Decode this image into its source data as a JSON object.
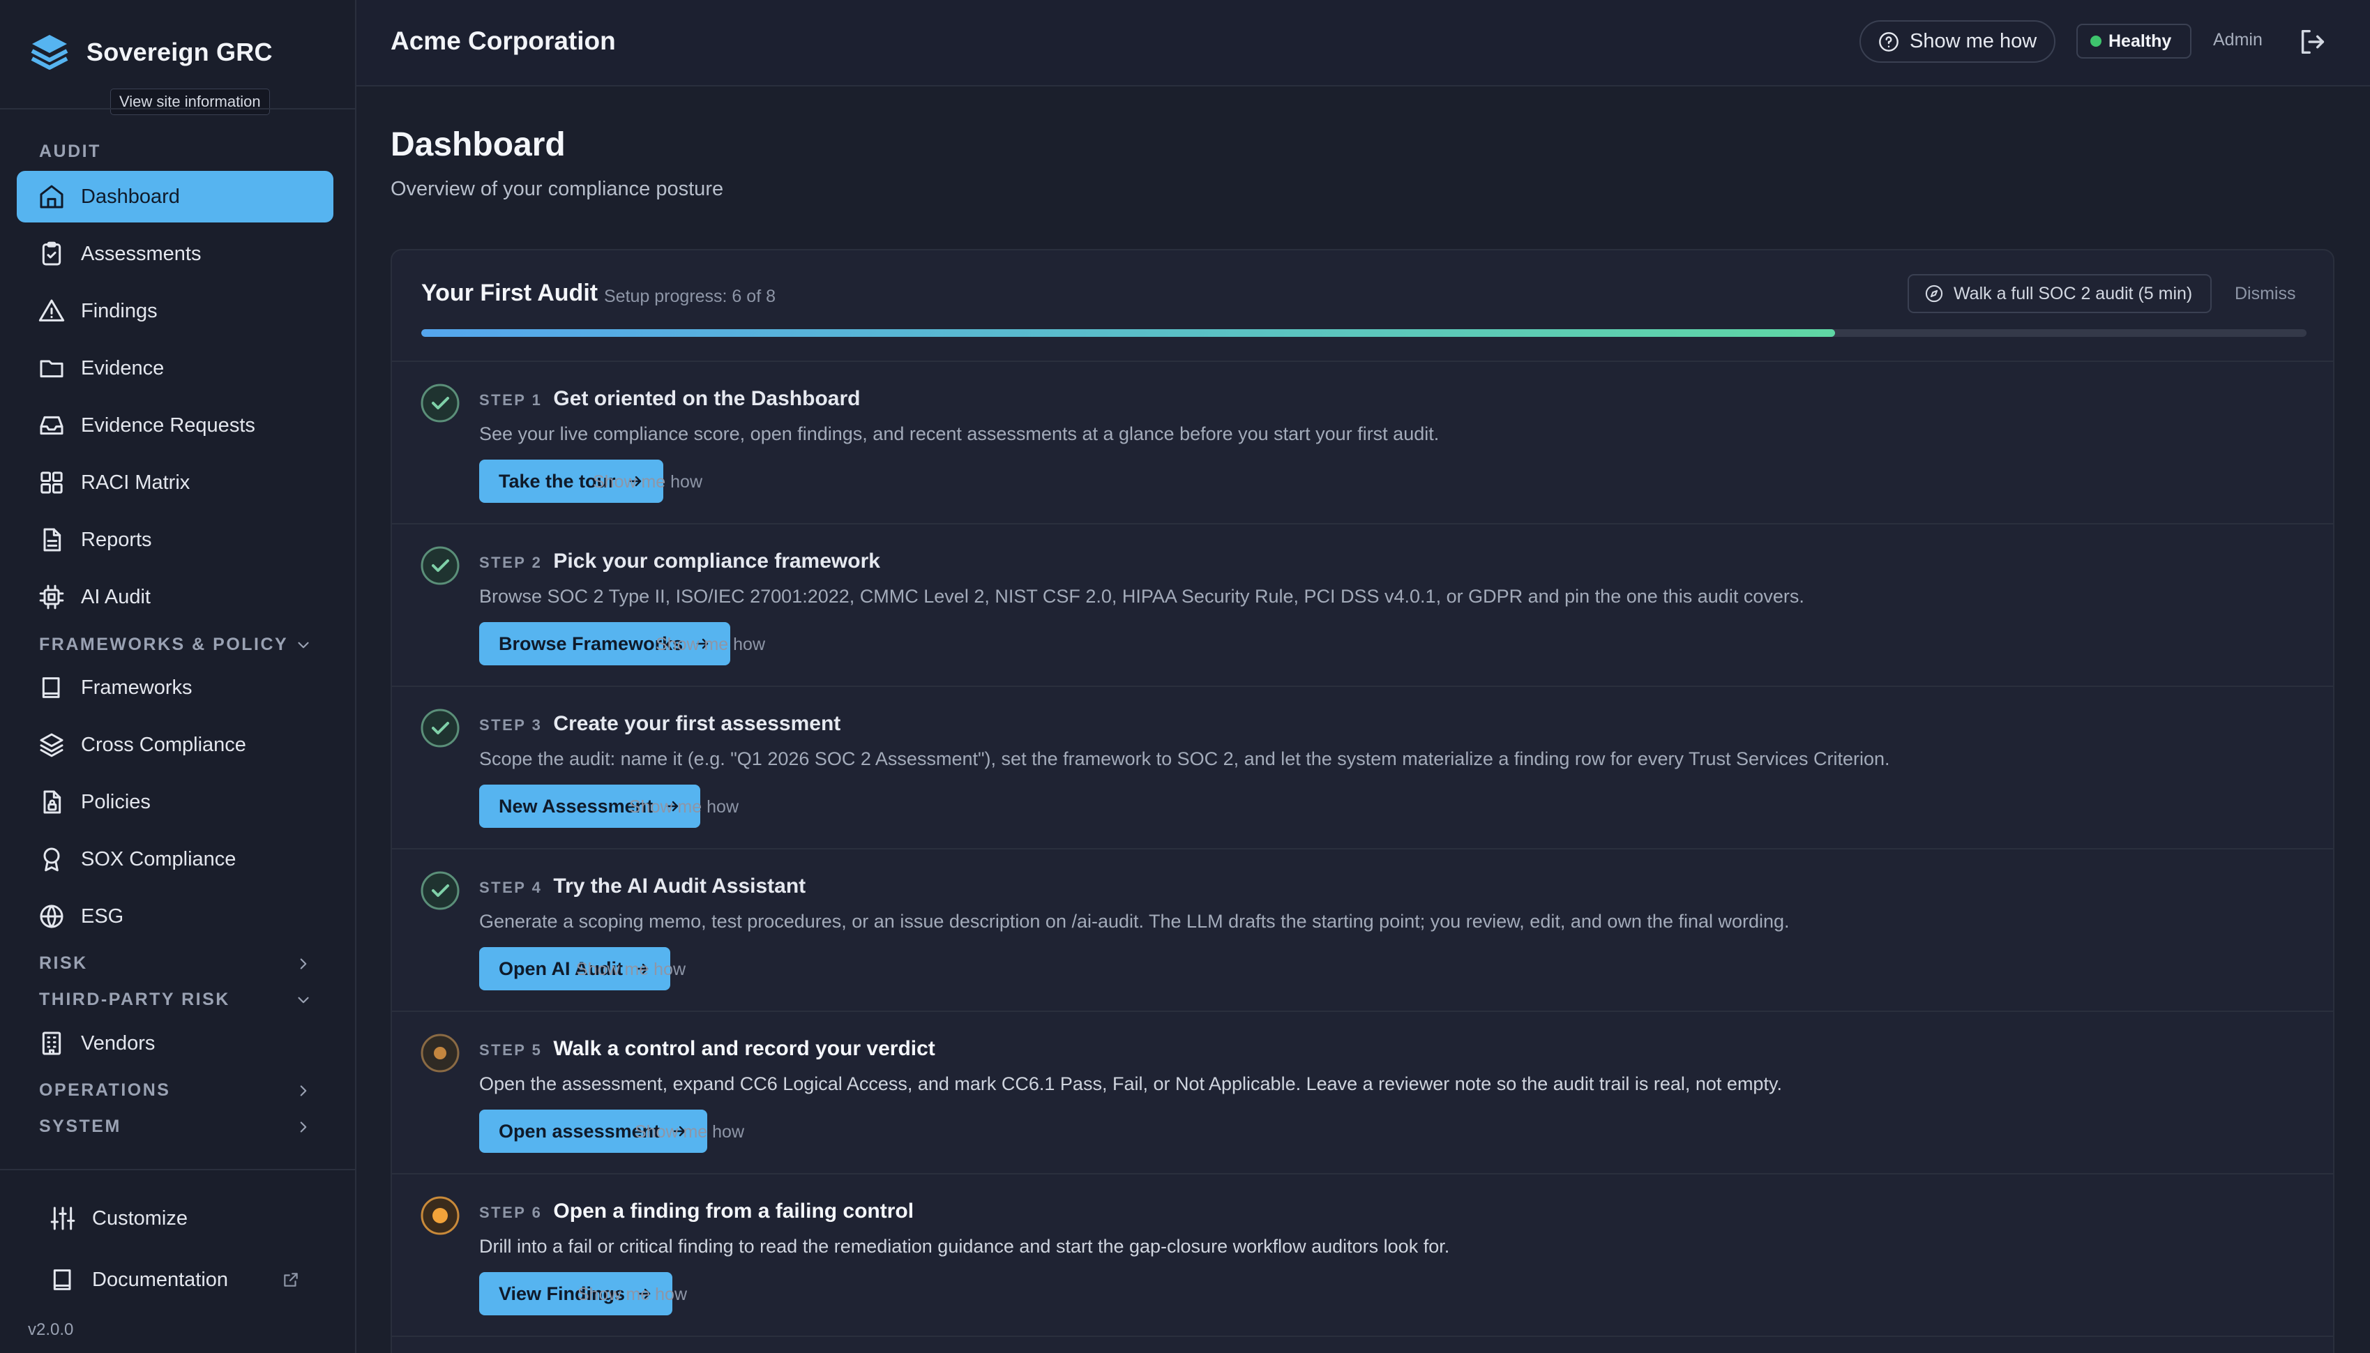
{
  "brand": {
    "name": "Sovereign GRC",
    "tooltip": "View site information"
  },
  "sidebar": {
    "sections": {
      "audit": "AUDIT",
      "frameworks": "FRAMEWORKS & POLICY",
      "risk": "RISK",
      "third_party": "THIRD-PARTY RISK",
      "operations": "OPERATIONS",
      "system": "SYSTEM"
    },
    "items": [
      {
        "label": "Dashboard",
        "icon": "home-icon",
        "active": true
      },
      {
        "label": "Assessments",
        "icon": "clipboard-check-icon"
      },
      {
        "label": "Findings",
        "icon": "warning-triangle-icon"
      },
      {
        "label": "Evidence",
        "icon": "folder-icon"
      },
      {
        "label": "Evidence Requests",
        "icon": "inbox-icon"
      },
      {
        "label": "RACI Matrix",
        "icon": "grid-icon"
      },
      {
        "label": "Reports",
        "icon": "document-icon"
      },
      {
        "label": "AI Audit",
        "icon": "cpu-icon"
      },
      {
        "label": "Frameworks",
        "icon": "book-icon"
      },
      {
        "label": "Cross Compliance",
        "icon": "layers-icon"
      },
      {
        "label": "Policies",
        "icon": "file-lock-icon"
      },
      {
        "label": "SOX Compliance",
        "icon": "award-icon"
      },
      {
        "label": "ESG",
        "icon": "globe-icon"
      },
      {
        "label": "Vendors",
        "icon": "building-icon"
      }
    ],
    "bottom": {
      "customize": "Customize",
      "documentation": "Documentation",
      "version": "v2.0.0"
    }
  },
  "header": {
    "org": "Acme Corporation",
    "show_me_how": "Show me how",
    "health": "Healthy",
    "health_color": "#3ec46d",
    "user": "Admin"
  },
  "page": {
    "title": "Dashboard",
    "subtitle": "Overview of your compliance posture"
  },
  "onboarding": {
    "title": "Your First Audit",
    "progress_text": "Setup progress: 6 of 8",
    "progress_fraction": 0.75,
    "walk_button": "Walk a full SOC 2 audit (5 min)",
    "dismiss": "Dismiss",
    "steps": [
      {
        "num": "STEP 1",
        "title": "Get oriented on the Dashboard",
        "desc": "See your live compliance score, open findings, and recent assessments at a glance before you start your first audit.",
        "button": "Take the tour",
        "how": "Show me how",
        "status": "done"
      },
      {
        "num": "STEP 2",
        "title": "Pick your compliance framework",
        "desc": "Browse SOC 2 Type II, ISO/IEC 27001:2022, CMMC Level 2, NIST CSF 2.0, HIPAA Security Rule, PCI DSS v4.0.1, or GDPR and pin the one this audit covers.",
        "button": "Browse Frameworks",
        "how": "Show me how",
        "status": "done"
      },
      {
        "num": "STEP 3",
        "title": "Create your first assessment",
        "desc": "Scope the audit: name it (e.g. \"Q1 2026 SOC 2 Assessment\"), set the framework to SOC 2, and let the system materialize a finding row for every Trust Services Criterion.",
        "button": "New Assessment",
        "how": "Show me how",
        "status": "done"
      },
      {
        "num": "STEP 4",
        "title": "Try the AI Audit Assistant",
        "desc": "Generate a scoping memo, test procedures, or an issue description on /ai-audit. The LLM drafts the starting point; you review, edit, and own the final wording.",
        "button": "Open AI Audit",
        "how": "Show me how",
        "status": "done"
      },
      {
        "num": "STEP 5",
        "title": "Walk a control and record your verdict",
        "desc": "Open the assessment, expand CC6 Logical Access, and mark CC6.1 Pass, Fail, or Not Applicable. Leave a reviewer note so the audit trail is real, not empty.",
        "button": "Open assessment",
        "how": "Show me how",
        "status": "pending"
      },
      {
        "num": "STEP 6",
        "title": "Open a finding from a failing control",
        "desc": "Drill into a fail or critical finding to read the remediation guidance and start the gap-closure workflow auditors look for.",
        "button": "View Findings",
        "how": "Show me how",
        "status": "pending"
      }
    ]
  }
}
